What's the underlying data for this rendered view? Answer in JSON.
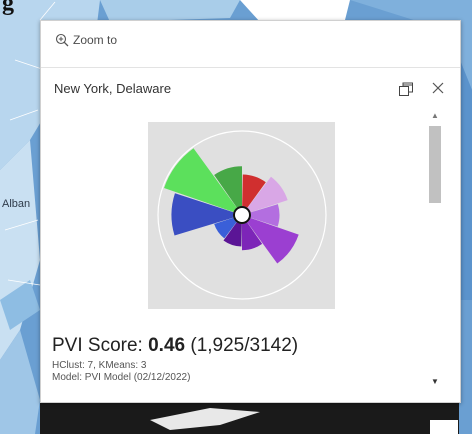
{
  "map": {
    "top_glyph": "g",
    "albany_label": "Alban"
  },
  "popup": {
    "zoom_label": "Zoom to",
    "title": "New York, Delaware",
    "pvi_label": "PVI Score: ",
    "pvi_value": "0.46",
    "pvi_rank": " (1,925/3142)",
    "clusters": "HClust: 7, KMeans: 3",
    "model": "Model: PVI Model (02/12/2022)"
  },
  "chart_data": {
    "type": "radial-bar",
    "max": 1,
    "slices": [
      {
        "value": 0.42,
        "color": "#d02f2f"
      },
      {
        "value": 0.52,
        "color": "#d9a7e6"
      },
      {
        "value": 0.38,
        "color": "#b36ee0"
      },
      {
        "value": 0.68,
        "color": "#9b3fd1"
      },
      {
        "value": 0.35,
        "color": "#7d25b8"
      },
      {
        "value": 0.3,
        "color": "#5b1596"
      },
      {
        "value": 0.27,
        "color": "#3a5fd8"
      },
      {
        "value": 0.82,
        "color": "#3a4ec2"
      },
      {
        "value": 0.98,
        "color": "#5ce05c"
      },
      {
        "value": 0.53,
        "color": "#47a847"
      }
    ]
  }
}
